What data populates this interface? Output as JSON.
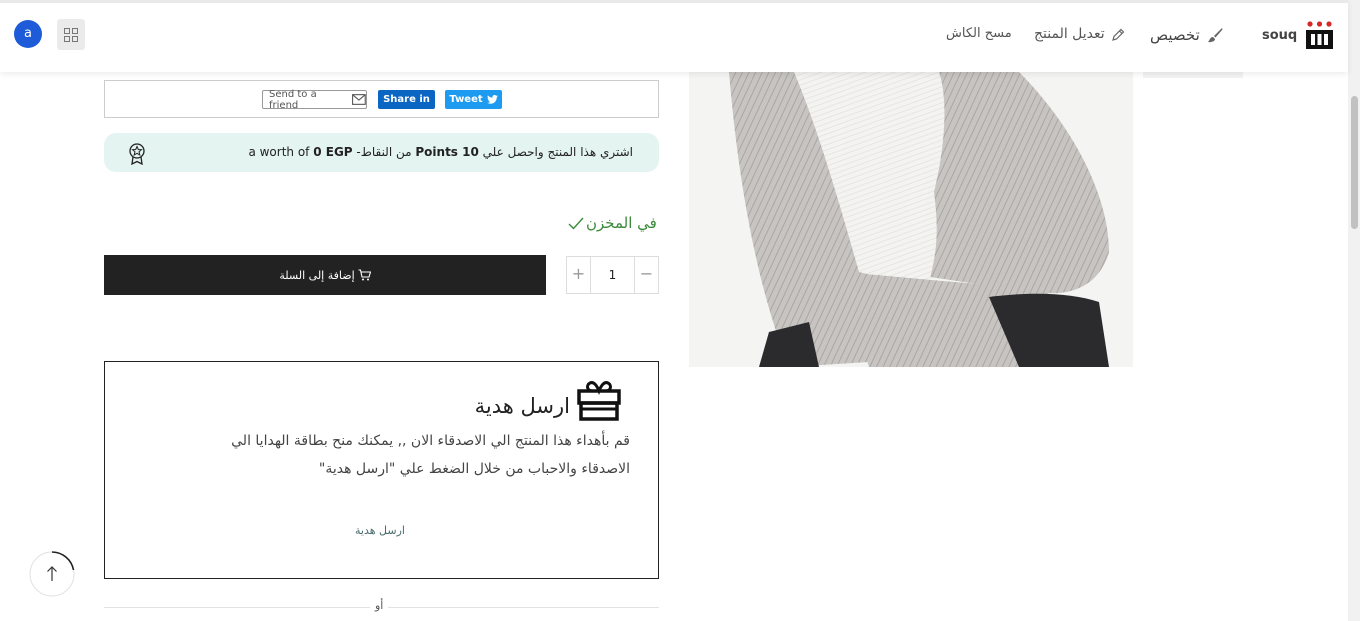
{
  "header": {
    "user_initial": "a",
    "brand": "souq",
    "nav": {
      "customize": "تخصيص",
      "edit_product": "تعديل المنتج",
      "clear_cash": "مسح الكاش"
    }
  },
  "share": {
    "send_to_friend": "Send to a friend",
    "share_linkedin": "Share in",
    "tweet": "Tweet"
  },
  "points": {
    "prefix": "اشتري هذا المنتج واحصل علي ",
    "points_value": "10 Points",
    "middle": " من النقاط- a worth of ",
    "worth_value": "0 EGP"
  },
  "stock": {
    "label": "في المخزن"
  },
  "cart": {
    "quantity": "1",
    "add_to_cart": "إضافة إلى السلة"
  },
  "gift": {
    "title": "ارسل هدية",
    "description_line1": "قم بأهداء هذا المنتج الي الاصدقاء الان ,, يمكنك منح بطاقة الهدايا الي",
    "description_line2": "الاصدقاء والاحباب من خلال الضغط علي \"ارسل هدية\"",
    "link": "ارسل هدية"
  },
  "divider": {
    "or": "أو"
  },
  "colors": {
    "avatar": "#1e5bd8",
    "linkedin": "#0a66c2",
    "twitter": "#1d9bf0",
    "points_bg": "#e4f4f1",
    "in_stock": "#3b8a3b",
    "cart_button": "#222222",
    "logo_red": "#d62828"
  },
  "icons": {
    "apps": "grid-icon",
    "customize": "brush-icon",
    "edit": "pencil-icon",
    "send_friend": "envelope-icon",
    "tweet": "twitter-bird-icon",
    "points": "medal-icon",
    "stock": "check-icon",
    "cart": "cart-icon",
    "gift": "gift-icon",
    "back_to_top": "arrow-up-icon"
  }
}
